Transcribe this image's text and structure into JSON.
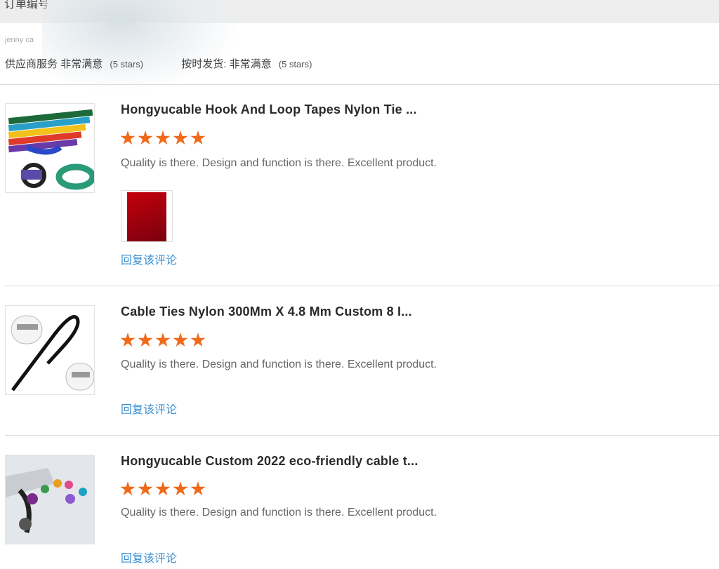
{
  "header": {
    "order_label": "订单编号"
  },
  "reviewer": {
    "name": "jenny ca"
  },
  "ratings": [
    {
      "label": "供应商服务",
      "value": "非常满意",
      "stars_note": "(5 stars)"
    },
    {
      "label": "按时发货:",
      "value": "非常满意",
      "stars_note": "(5 stars)"
    }
  ],
  "reviews": [
    {
      "title": "Hongyucable Hook And Loop Tapes Nylon Tie ...",
      "stars": 5,
      "comment": "Quality is there. Design and function is there. Excellent product.",
      "has_photo": true,
      "reply_label": "回复该评论"
    },
    {
      "title": "Cable Ties Nylon 300Mm X 4.8 Mm Custom 8 I...",
      "stars": 5,
      "comment": "Quality is there. Design and function is there. Excellent product.",
      "has_photo": false,
      "reply_label": "回复该评论"
    },
    {
      "title": "Hongyucable Custom 2022 eco-friendly cable t...",
      "stars": 5,
      "comment": "Quality is there. Design and function is there. Excellent product.",
      "has_photo": false,
      "reply_label": "回复该评论"
    }
  ],
  "colors": {
    "star": "#f06a1a",
    "link": "#3a8fd2",
    "header_bg": "#ededed"
  }
}
